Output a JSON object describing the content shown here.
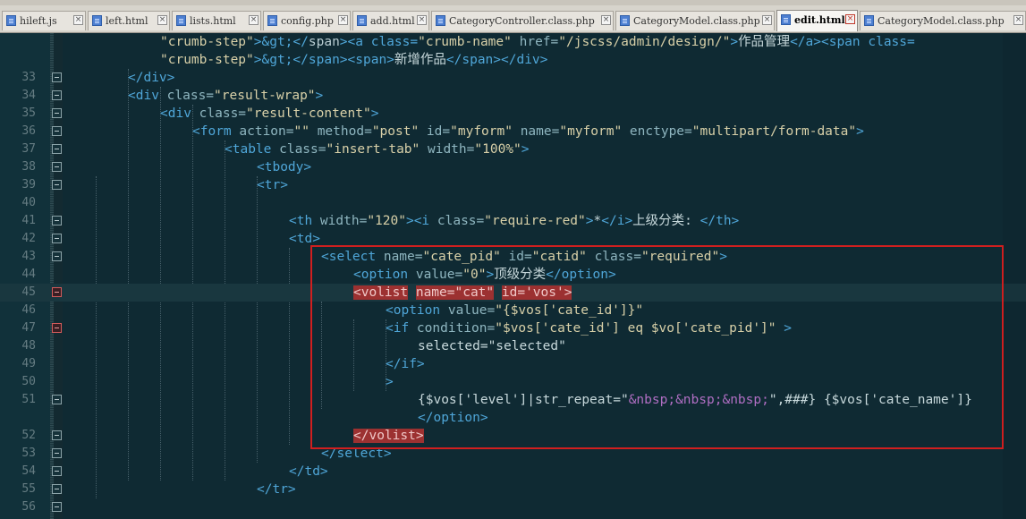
{
  "tabs": [
    {
      "label": "hileft.js",
      "active": false
    },
    {
      "label": "left.html",
      "active": false
    },
    {
      "label": "lists.html",
      "active": false
    },
    {
      "label": "config.php",
      "active": false
    },
    {
      "label": "add.html",
      "active": false
    },
    {
      "label": "CategoryController.class.php",
      "active": false
    },
    {
      "label": "CategoryModel.class.php",
      "active": false
    },
    {
      "label": "edit.html",
      "active": true
    },
    {
      "label": "CategoryModel.class.php",
      "active": false
    }
  ],
  "editor": {
    "current_line": "45",
    "lines": [
      {
        "num": "",
        "tokens": [
          [
            "\"crumb-step\"",
            "str"
          ],
          [
            ">&gt;</",
            "tag"
          ],
          [
            "span",
            ""
          ],
          [
            "><",
            "tag"
          ],
          [
            "a class=",
            "tag"
          ],
          [
            "\"crumb-name\"",
            "str"
          ],
          [
            " href=",
            "attr"
          ],
          [
            "\"/jscss/admin/design/\"",
            "str"
          ],
          [
            ">",
            "tag"
          ],
          [
            "作品管理",
            "txt"
          ],
          [
            "</a><span class=",
            "tag"
          ]
        ]
      },
      {
        "num": "",
        "tokens": [
          [
            "\"crumb-step\"",
            "str"
          ],
          [
            ">&gt;</span><span>",
            "tag"
          ],
          [
            "新增作品",
            "txt"
          ],
          [
            "</span></div>",
            "tag"
          ]
        ]
      },
      {
        "num": "33",
        "tokens": [
          [
            "</div>",
            "tag"
          ]
        ]
      },
      {
        "num": "34",
        "tokens": [
          [
            "<div ",
            "tag"
          ],
          [
            "class=",
            "attr"
          ],
          [
            "\"result-wrap\"",
            "str"
          ],
          [
            ">",
            "tag"
          ]
        ]
      },
      {
        "num": "35",
        "tokens": [
          [
            "<div ",
            "tag"
          ],
          [
            "class=",
            "attr"
          ],
          [
            "\"result-content\"",
            "str"
          ],
          [
            ">",
            "tag"
          ]
        ]
      },
      {
        "num": "36",
        "tokens": [
          [
            "<form ",
            "tag"
          ],
          [
            "action=",
            "attr"
          ],
          [
            "\"\"",
            "str"
          ],
          [
            " method=",
            "attr"
          ],
          [
            "\"post\"",
            "str"
          ],
          [
            " id=",
            "attr"
          ],
          [
            "\"myform\"",
            "str"
          ],
          [
            " name=",
            "attr"
          ],
          [
            "\"myform\"",
            "str"
          ],
          [
            " enctype=",
            "attr"
          ],
          [
            "\"multipart/form-data\"",
            "str"
          ],
          [
            ">",
            "tag"
          ]
        ]
      },
      {
        "num": "37",
        "tokens": [
          [
            "<table ",
            "tag"
          ],
          [
            "class=",
            "attr"
          ],
          [
            "\"insert-tab\"",
            "str"
          ],
          [
            " width=",
            "attr"
          ],
          [
            "\"100%\"",
            "str"
          ],
          [
            ">",
            "tag"
          ]
        ]
      },
      {
        "num": "38",
        "tokens": [
          [
            "<tbody>",
            "tag"
          ]
        ]
      },
      {
        "num": "39",
        "tokens": [
          [
            "<tr>",
            "tag"
          ]
        ]
      },
      {
        "num": "40",
        "tokens": []
      },
      {
        "num": "41",
        "tokens": [
          [
            "<th ",
            "tag"
          ],
          [
            "width=",
            "attr"
          ],
          [
            "\"120\"",
            "str"
          ],
          [
            "><i ",
            "tag"
          ],
          [
            "class=",
            "attr"
          ],
          [
            "\"require-red\"",
            "str"
          ],
          [
            ">",
            "tag"
          ],
          [
            "*",
            "txt"
          ],
          [
            "</i>",
            "tag"
          ],
          [
            "上级分类:",
            "txt"
          ],
          [
            " </th>",
            "tag"
          ]
        ]
      },
      {
        "num": "42",
        "tokens": [
          [
            "<td>",
            "tag"
          ]
        ]
      },
      {
        "num": "43",
        "tokens": [
          [
            "<select ",
            "tag"
          ],
          [
            "name=",
            "attr"
          ],
          [
            "\"cate_pid\"",
            "str"
          ],
          [
            " id=",
            "attr"
          ],
          [
            "\"catid\"",
            "str"
          ],
          [
            " class=",
            "attr"
          ],
          [
            "\"required\"",
            "str"
          ],
          [
            ">",
            "tag"
          ]
        ]
      },
      {
        "num": "44",
        "tokens": [
          [
            "<option ",
            "tag"
          ],
          [
            "value=",
            "attr"
          ],
          [
            "\"0\"",
            "str"
          ],
          [
            ">",
            "tag"
          ],
          [
            "顶级分类",
            "txt"
          ],
          [
            "</option>",
            "tag"
          ]
        ]
      },
      {
        "num": "45",
        "tokens": [
          [
            "<volist",
            "hl"
          ],
          [
            " ",
            ""
          ],
          [
            "name=\"cat\"",
            "hl"
          ],
          [
            " ",
            ""
          ],
          [
            "id='vos'>",
            "hl"
          ]
        ]
      },
      {
        "num": "46",
        "tokens": [
          [
            "<option ",
            "tag"
          ],
          [
            "value=",
            "attr"
          ],
          [
            "\"{$vos['cate_id']}\"",
            "str"
          ]
        ]
      },
      {
        "num": "47",
        "tokens": [
          [
            "<if ",
            "tag"
          ],
          [
            "condition=",
            "attr"
          ],
          [
            "\"$vos['cate_id'] eq $vo['cate_pid']\"",
            "str"
          ],
          [
            " >",
            "tag"
          ]
        ]
      },
      {
        "num": "48",
        "tokens": [
          [
            "selected=\"selected\"",
            "txt"
          ]
        ]
      },
      {
        "num": "49",
        "tokens": [
          [
            "</if>",
            "tag"
          ]
        ]
      },
      {
        "num": "50",
        "tokens": [
          [
            ">",
            "tag"
          ]
        ]
      },
      {
        "num": "51",
        "tokens": [
          [
            "{$vos['level']|str_repeat=\"",
            "txt"
          ],
          [
            "&nbsp;&nbsp;&nbsp;",
            "ent"
          ],
          [
            "\",###} {$vos['cate_name']}",
            "txt"
          ]
        ]
      },
      {
        "num": "",
        "tokens": [
          [
            "</option>",
            "tag"
          ]
        ]
      },
      {
        "num": "52",
        "tokens": [
          [
            "</volist>",
            "hl"
          ]
        ]
      },
      {
        "num": "53",
        "tokens": [
          [
            "</select>",
            "tag"
          ]
        ]
      },
      {
        "num": "54",
        "tokens": [
          [
            "</td>",
            "tag"
          ]
        ]
      },
      {
        "num": "55",
        "tokens": [
          [
            "</tr>",
            "tag"
          ]
        ]
      },
      {
        "num": "56",
        "tokens": []
      }
    ]
  }
}
